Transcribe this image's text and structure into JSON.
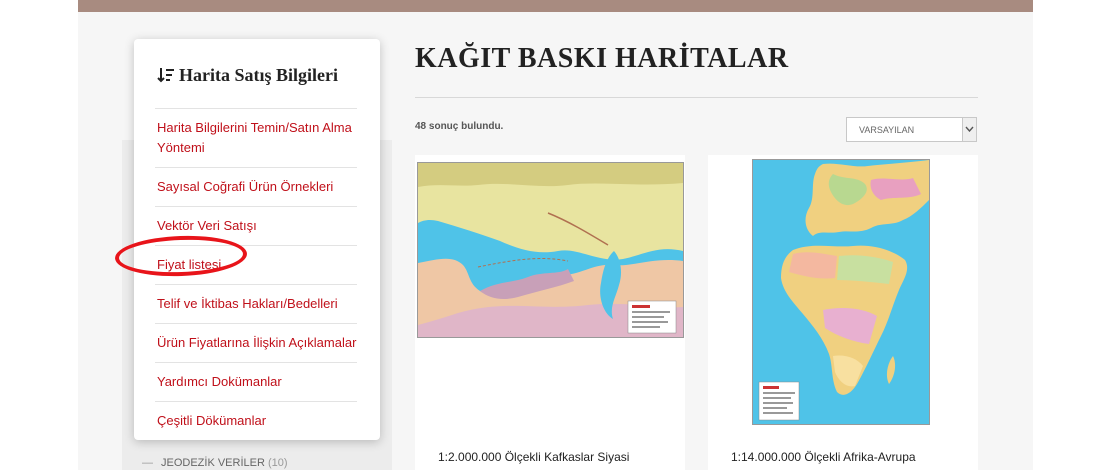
{
  "sidebar": {
    "title": "Harita Satış Bilgileri",
    "items": [
      {
        "label": "Harita Bilgilerini Temin/Satın Alma Yöntemi"
      },
      {
        "label": "Sayısal Coğrafi Ürün Örnekleri"
      },
      {
        "label": "Vektör Veri Satışı"
      },
      {
        "label": "Fiyat listesi"
      },
      {
        "label": "Telif ve İktibas Hakları/Bedelleri"
      },
      {
        "label": "Ürün Fiyatlarına İlişkin Açıklamalar"
      },
      {
        "label": "Yardımcı Dokümanlar"
      },
      {
        "label": "Çeşitli Dökümanlar"
      }
    ],
    "bg_item": {
      "label": "JEODEZİK VERİLER",
      "count": "(10)"
    }
  },
  "main": {
    "title": "KAĞIT BASKI HARİTALAR",
    "result_count": "48 sonuç bulundu.",
    "sort": {
      "selected": "VARSAYILAN"
    },
    "products": [
      {
        "name": "1:2.000.000 Ölçekli Kafkaslar Siyasi"
      },
      {
        "name": "1:14.000.000 Ölçekli Afrika-Avrupa"
      }
    ]
  },
  "colors": {
    "link": "#c0101a",
    "highlight_circle": "#e8141a",
    "top_bar": "#a88b80",
    "sea": "#4fc3e8"
  }
}
